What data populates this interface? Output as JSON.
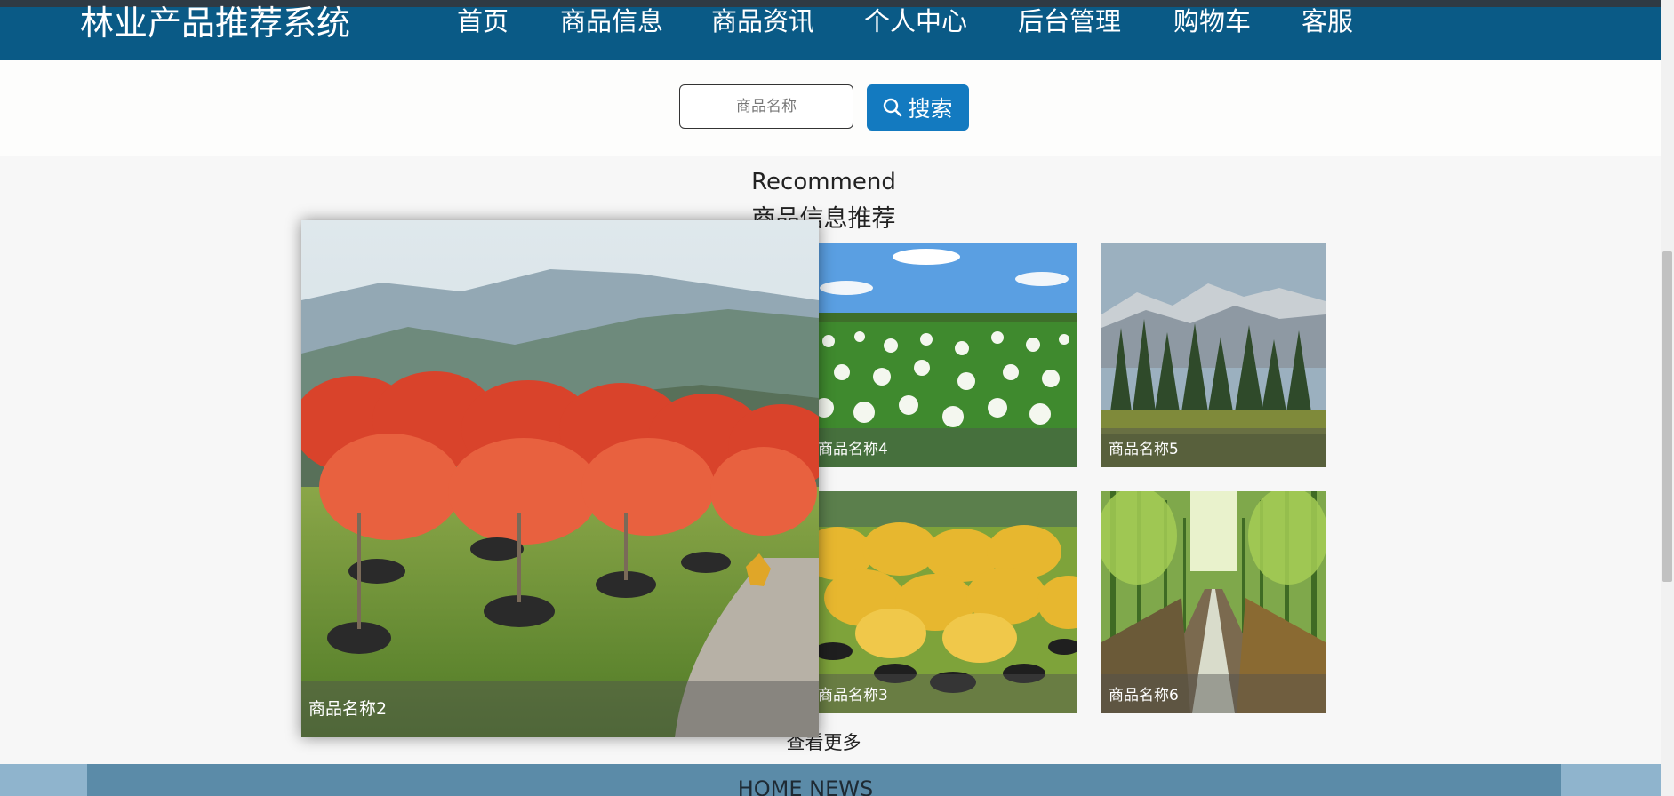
{
  "nav": {
    "brand": "林业产品推荐系统",
    "items": [
      {
        "label": "首页",
        "active": true
      },
      {
        "label": "商品信息"
      },
      {
        "label": "商品资讯"
      },
      {
        "label": "个人中心"
      },
      {
        "label": "后台管理"
      },
      {
        "label": "购物车"
      },
      {
        "label": "客服"
      }
    ],
    "colors": {
      "nav_bg": "#0a5a86",
      "accent": "#137ac0"
    }
  },
  "search": {
    "placeholder": "商品名称",
    "button_label": "搜索",
    "button_icon": "search-icon"
  },
  "recommend": {
    "title_en": "Recommend",
    "title_cn": "商品信息推荐",
    "items": [
      {
        "name": "商品名称2",
        "scene": "red maple nursery with mountains"
      },
      {
        "name": "商品名称4",
        "scene": "white flower field under blue sky"
      },
      {
        "name": "商品名称5",
        "scene": "pine forest with snowy mountains"
      },
      {
        "name": "商品名称3",
        "scene": "yellow saplings nursery"
      },
      {
        "name": "商品名称6",
        "scene": "tree-lined forest road"
      }
    ],
    "more_label": "查看更多"
  },
  "news": {
    "title": "HOME NEWS"
  }
}
